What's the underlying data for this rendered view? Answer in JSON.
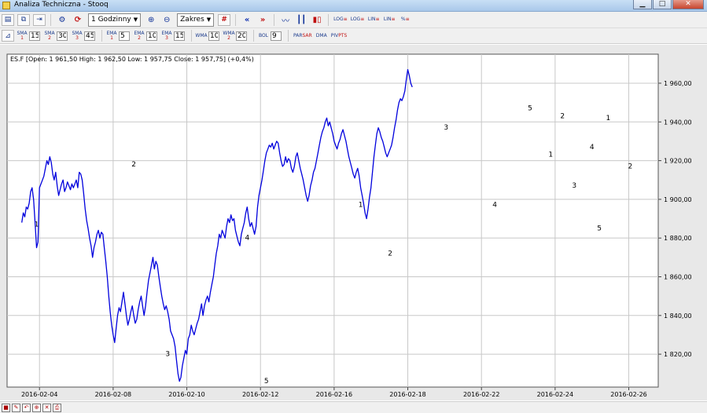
{
  "window": {
    "title": "Analiza Techniczna - Stooq"
  },
  "toolbar": {
    "interval": "1 Godzinny",
    "range": "Zakres",
    "nav_prev": "«",
    "nav_next": "»",
    "log_buttons": [
      {
        "top": "LOG",
        "bottom": "≡"
      },
      {
        "top": "LOG",
        "bottom": "≡"
      },
      {
        "top": "LIN",
        "bottom": "≡"
      },
      {
        "top": "LIN",
        "bottom": "≡"
      },
      {
        "top": "%",
        "bottom": "≡"
      }
    ]
  },
  "indicators": {
    "sma1": {
      "label": "SMA",
      "sub": "1",
      "value": "15"
    },
    "sma2": {
      "label": "SMA",
      "sub": "2",
      "value": "30"
    },
    "sma3": {
      "label": "SMA",
      "sub": "3",
      "value": "45"
    },
    "ema1": {
      "label": "EMA",
      "sub": "1",
      "value": "5"
    },
    "ema2": {
      "label": "EMA",
      "sub": "2",
      "value": "10"
    },
    "ema3": {
      "label": "EMA",
      "sub": "3",
      "value": "15"
    },
    "wma1": {
      "label": "WMA",
      "sub": "",
      "value": "10"
    },
    "wma2": {
      "label": "WMA",
      "sub": "2",
      "value": "20"
    },
    "bol": {
      "label": "BOL",
      "sub": "",
      "value": "9"
    },
    "par_sar": {
      "top": "PAR",
      "bottom": "SAR"
    },
    "dma": {
      "top": "DMA",
      "bottom": ""
    },
    "piv_pts": {
      "top": "PIV",
      "bottom": "PTS"
    }
  },
  "chart_data": {
    "type": "line",
    "title": "ES.F [Open: 1 961,50  High: 1 962,50  Low: 1 957,75  Close: 1 957,75] (+0,4%)",
    "series_color": "#0000dd",
    "ylim": [
      1803,
      1975
    ],
    "y_ticks": [
      {
        "value": 1820,
        "label": "1 820,00"
      },
      {
        "value": 1840,
        "label": "1 840,00"
      },
      {
        "value": 1860,
        "label": "1 860,00"
      },
      {
        "value": 1880,
        "label": "1 880,00"
      },
      {
        "value": 1900,
        "label": "1 900,00"
      },
      {
        "value": 1920,
        "label": "1 920,00"
      },
      {
        "value": 1940,
        "label": "1 940,00"
      },
      {
        "value": 1960,
        "label": "1 960,00"
      }
    ],
    "x_ticks": [
      "2016-02-04",
      "2016-02-08",
      "2016-02-10",
      "2016-02-12",
      "2016-02-16",
      "2016-02-18",
      "2016-02-22",
      "2016-02-24",
      "2016-02-26"
    ],
    "x_tick_index": [
      12,
      62,
      112,
      162,
      212,
      262,
      312,
      362,
      412
    ],
    "x_domain": [
      -10,
      432
    ],
    "series": [
      {
        "values": [
          1888,
          1893,
          1891,
          1896,
          1895,
          1898,
          1904,
          1906,
          1900,
          1888,
          1875,
          1878,
          1906,
          1908,
          1910,
          1912,
          1916,
          1920,
          1918,
          1922,
          1919,
          1913,
          1910,
          1914,
          1907,
          1902,
          1905,
          1908,
          1910,
          1904,
          1906,
          1909,
          1907,
          1905,
          1908,
          1906,
          1908,
          1910,
          1906,
          1914,
          1913,
          1910,
          1903,
          1895,
          1889,
          1885,
          1880,
          1876,
          1870,
          1875,
          1878,
          1882,
          1884,
          1880,
          1883,
          1882,
          1875,
          1868,
          1860,
          1850,
          1842,
          1835,
          1830,
          1826,
          1833,
          1840,
          1844,
          1842,
          1847,
          1852,
          1846,
          1840,
          1835,
          1838,
          1842,
          1845,
          1840,
          1836,
          1838,
          1843,
          1847,
          1850,
          1845,
          1840,
          1845,
          1852,
          1858,
          1862,
          1866,
          1870,
          1864,
          1868,
          1866,
          1860,
          1855,
          1850,
          1846,
          1843,
          1845,
          1842,
          1838,
          1832,
          1830,
          1828,
          1824,
          1817,
          1810,
          1806,
          1808,
          1814,
          1818,
          1822,
          1820,
          1828,
          1830,
          1835,
          1832,
          1830,
          1833,
          1836,
          1838,
          1842,
          1846,
          1840,
          1845,
          1848,
          1850,
          1847,
          1852,
          1856,
          1860,
          1866,
          1872,
          1876,
          1882,
          1880,
          1884,
          1882,
          1880,
          1886,
          1890,
          1888,
          1892,
          1889,
          1890,
          1884,
          1881,
          1878,
          1876,
          1882,
          1885,
          1888,
          1893,
          1896,
          1890,
          1886,
          1888,
          1885,
          1882,
          1886,
          1896,
          1902,
          1906,
          1910,
          1915,
          1920,
          1924,
          1926,
          1928,
          1927,
          1929,
          1926,
          1928,
          1930,
          1929,
          1924,
          1920,
          1917,
          1918,
          1922,
          1919,
          1921,
          1920,
          1916,
          1914,
          1917,
          1922,
          1924,
          1920,
          1916,
          1913,
          1910,
          1906,
          1902,
          1899,
          1902,
          1907,
          1910,
          1914,
          1916,
          1920,
          1924,
          1928,
          1932,
          1935,
          1937,
          1940,
          1942,
          1938,
          1940,
          1937,
          1934,
          1930,
          1928,
          1926,
          1929,
          1931,
          1934,
          1936,
          1933,
          1930,
          1926,
          1922,
          1919,
          1916,
          1913,
          1911,
          1914,
          1916,
          1912,
          1906,
          1902,
          1898,
          1893,
          1890,
          1895,
          1901,
          1906,
          1914,
          1922,
          1928,
          1934,
          1937,
          1935,
          1932,
          1930,
          1927,
          1924,
          1922,
          1924,
          1926,
          1928,
          1932,
          1937,
          1941,
          1946,
          1950,
          1952,
          1951,
          1953,
          1956,
          1962,
          1967,
          1964,
          1960,
          1958
        ]
      }
    ],
    "wave_labels": [
      {
        "text": "1",
        "x": 10,
        "y": 1886
      },
      {
        "text": "2",
        "x": 76,
        "y": 1917
      },
      {
        "text": "3",
        "x": 99,
        "y": 1819
      },
      {
        "text": "4",
        "x": 153,
        "y": 1879
      },
      {
        "text": "5",
        "x": 166,
        "y": 1805
      },
      {
        "text": "1",
        "x": 230,
        "y": 1896
      },
      {
        "text": "2",
        "x": 250,
        "y": 1871
      },
      {
        "text": "3",
        "x": 288,
        "y": 1936
      },
      {
        "text": "4",
        "x": 321,
        "y": 1896
      },
      {
        "text": "5",
        "x": 345,
        "y": 1946
      },
      {
        "text": "1",
        "x": 359,
        "y": 1922
      },
      {
        "text": "2",
        "x": 367,
        "y": 1942
      },
      {
        "text": "3",
        "x": 375,
        "y": 1906
      },
      {
        "text": "4",
        "x": 387,
        "y": 1926
      },
      {
        "text": "5",
        "x": 392,
        "y": 1884
      },
      {
        "text": "1",
        "x": 398,
        "y": 1941
      },
      {
        "text": "2",
        "x": 413,
        "y": 1916
      }
    ]
  }
}
